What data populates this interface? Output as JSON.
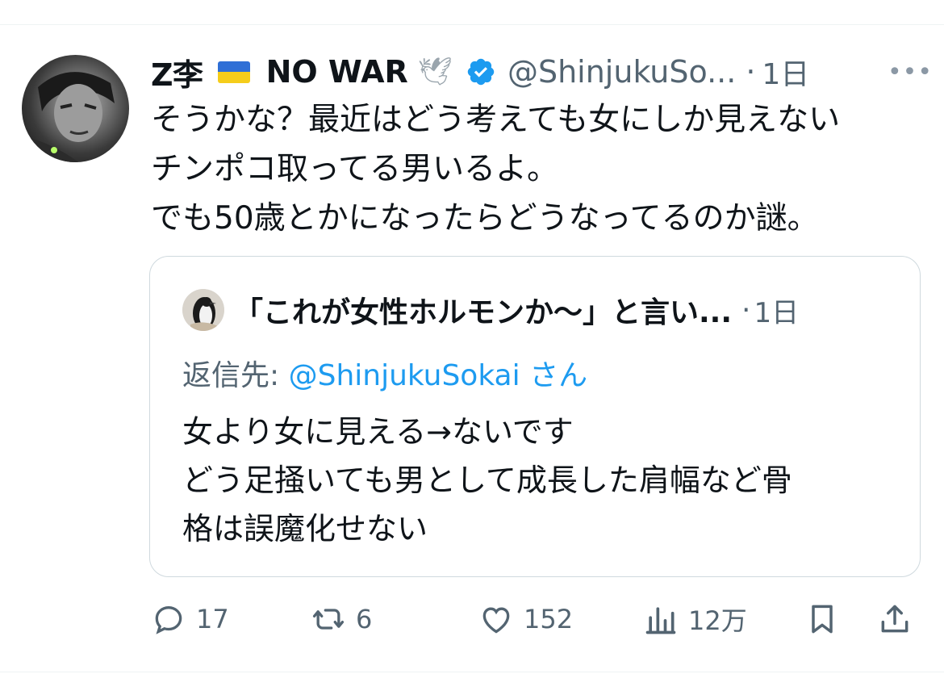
{
  "author": {
    "name": "Z李",
    "name_suffix": "NO WAR",
    "flag_icon": "ukraine-flag",
    "dove_glyph": "🕊",
    "handle": "@ShinjukuSo...",
    "dot": "·",
    "time": "1日",
    "more_glyph": "•••"
  },
  "tweet": {
    "lines": [
      "そうかな？最近はどう考えても女にしか見えない",
      "チンポコ取ってる男いるよ。",
      "でも50歳とかになったらどうなってるのか謎。"
    ]
  },
  "quote": {
    "name": "「これが女性ホルモンか〜」と言い...",
    "dot": "·",
    "time": "1日",
    "reply_prefix": "返信先:",
    "reply_handle": "@ShinjukuSokai",
    "reply_suffix": "さん",
    "lines": [
      "女より女に見える→ないです",
      "どう足掻いても男として成長した肩幅など骨",
      "格は誤魔化せない"
    ]
  },
  "actions": {
    "replies": "17",
    "retweets": "6",
    "likes": "152",
    "views": "12万"
  },
  "colors": {
    "text": "#0f1419",
    "muted": "#536471",
    "link": "#1d9bf0",
    "verified": "#1d9bf0",
    "border": "#cfd9de"
  }
}
